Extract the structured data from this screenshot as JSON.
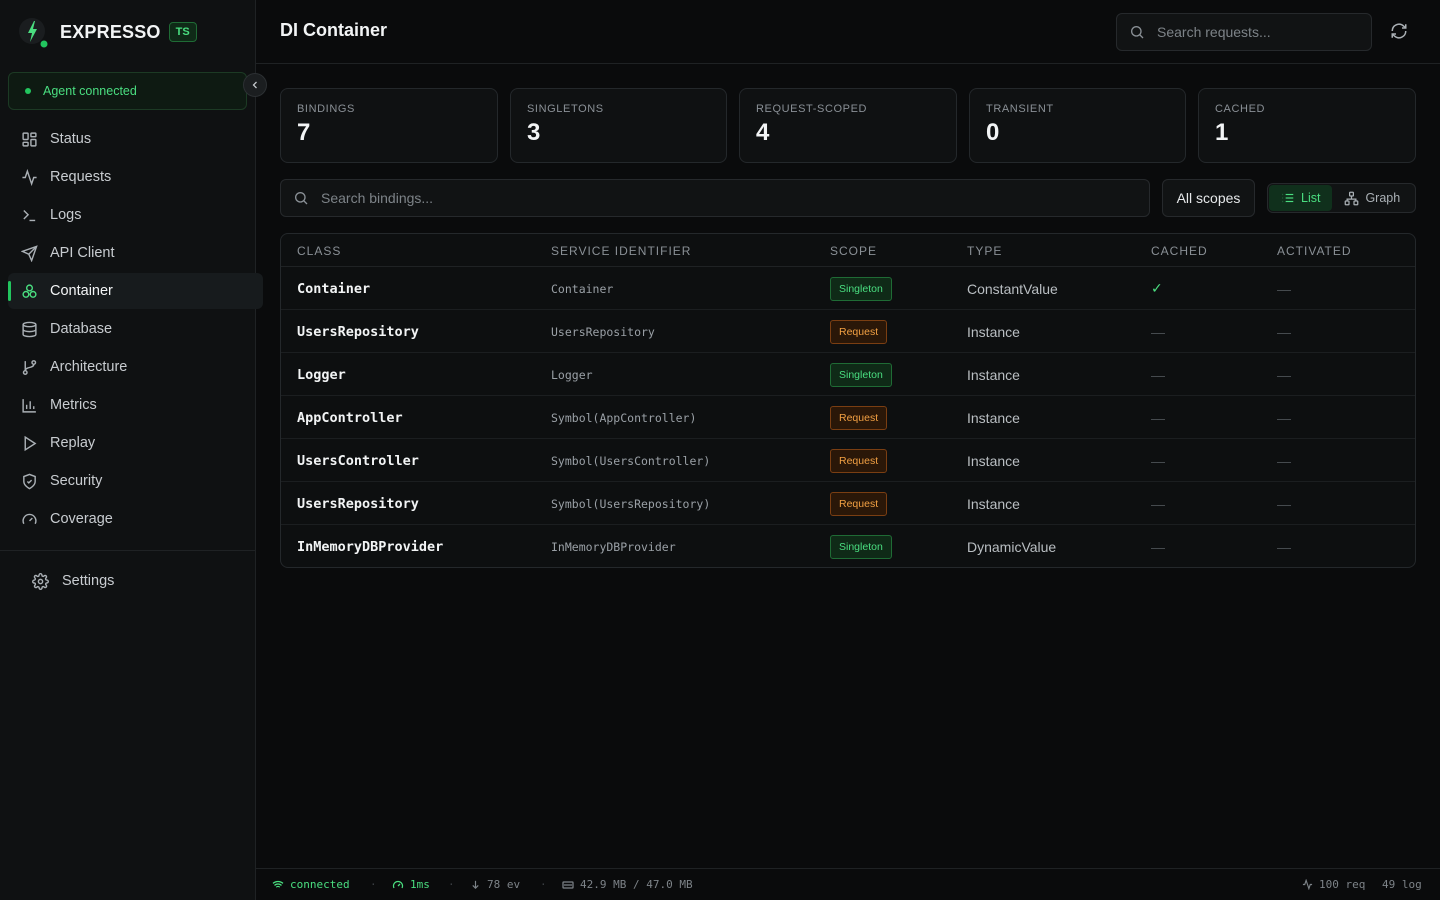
{
  "app": {
    "name": "EXPRESSO",
    "badge": "TS"
  },
  "agent": {
    "status": "Agent connected"
  },
  "sidebar": {
    "items": [
      {
        "label": "Status",
        "icon": "grid-icon"
      },
      {
        "label": "Requests",
        "icon": "activity-icon"
      },
      {
        "label": "Logs",
        "icon": "terminal-icon"
      },
      {
        "label": "API Client",
        "icon": "send-icon"
      },
      {
        "label": "Container",
        "icon": "boxes-icon",
        "active": true
      },
      {
        "label": "Database",
        "icon": "database-icon"
      },
      {
        "label": "Architecture",
        "icon": "git-branch-icon"
      },
      {
        "label": "Metrics",
        "icon": "bar-chart-icon"
      },
      {
        "label": "Replay",
        "icon": "play-icon"
      },
      {
        "label": "Security",
        "icon": "shield-icon"
      },
      {
        "label": "Coverage",
        "icon": "gauge-icon"
      }
    ],
    "settings": "Settings"
  },
  "header": {
    "title": "DI Container",
    "search_placeholder": "Search requests..."
  },
  "stats": [
    {
      "label": "BINDINGS",
      "value": "7"
    },
    {
      "label": "SINGLETONS",
      "value": "3"
    },
    {
      "label": "REQUEST-SCOPED",
      "value": "4"
    },
    {
      "label": "TRANSIENT",
      "value": "0"
    },
    {
      "label": "CACHED",
      "value": "1"
    }
  ],
  "filters": {
    "search_placeholder": "Search bindings...",
    "scope": "All scopes",
    "view_list": "List",
    "view_graph": "Graph"
  },
  "table": {
    "headers": [
      "CLASS",
      "SERVICE IDENTIFIER",
      "SCOPE",
      "TYPE",
      "CACHED",
      "ACTIVATED"
    ],
    "rows": [
      {
        "cls": "Container",
        "sid": "Container",
        "scope": "Singleton",
        "type": "ConstantValue",
        "cached": "✓",
        "activated": "—"
      },
      {
        "cls": "UsersRepository",
        "sid": "UsersRepository",
        "scope": "Request",
        "type": "Instance",
        "cached": "—",
        "activated": "—"
      },
      {
        "cls": "Logger",
        "sid": "Logger",
        "scope": "Singleton",
        "type": "Instance",
        "cached": "—",
        "activated": "—"
      },
      {
        "cls": "AppController",
        "sid": "Symbol(AppController)",
        "scope": "Request",
        "type": "Instance",
        "cached": "—",
        "activated": "—"
      },
      {
        "cls": "UsersController",
        "sid": "Symbol(UsersController)",
        "scope": "Request",
        "type": "Instance",
        "cached": "—",
        "activated": "—"
      },
      {
        "cls": "UsersRepository",
        "sid": "Symbol(UsersRepository)",
        "scope": "Request",
        "type": "Instance",
        "cached": "—",
        "activated": "—"
      },
      {
        "cls": "InMemoryDBProvider",
        "sid": "InMemoryDBProvider",
        "scope": "Singleton",
        "type": "DynamicValue",
        "cached": "—",
        "activated": "—"
      }
    ]
  },
  "statusbar": {
    "connection": "connected",
    "latency": "1ms",
    "events": "78 ev",
    "memory": "42.9 MB / 47.0 MB",
    "requests": "100 req",
    "logs": "49 log"
  },
  "colors": {
    "accent": "#22c55e",
    "singleton": "#4ade80",
    "request": "#f2a043"
  }
}
